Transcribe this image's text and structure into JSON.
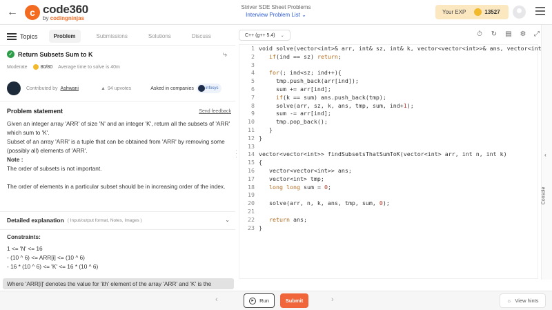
{
  "header": {
    "logo_mark": "c",
    "logo_text": "code360",
    "logo_sub_prefix": "by",
    "logo_sub_brand": "codingninjas",
    "crumb_top": "Striver SDE Sheet Problems",
    "crumb_bottom": "Interview Problem List",
    "exp_label": "Your EXP",
    "exp_value": "13527",
    "icons": {
      "back": "arrow-left-icon",
      "avatar": "user-avatar-icon",
      "menu": "hamburger-icon"
    }
  },
  "left_tabs": {
    "topics": "Topics",
    "items": [
      "Problem",
      "Submissions",
      "Solutions",
      "Discuss"
    ]
  },
  "problem": {
    "title": "Return Subsets Sum to K",
    "difficulty": "Moderate",
    "score": "80/80",
    "avg_time": "Average time to solve is 40m",
    "contributed_prefix": "Contributed by",
    "author": "Ashwani",
    "upvotes": "94 upvotes",
    "companies_label": "Asked in companies",
    "company_text": "infosys",
    "statement_title": "Problem statement",
    "feedback": "Send feedback",
    "para1": "Given an integer array 'ARR' of size 'N' and an integer 'K', return all the subsets of 'ARR' which sum to 'K'.",
    "para2": "Subset of an array 'ARR' is a tuple that can be obtained from 'ARR' by removing some (possibly all) elements of 'ARR'.",
    "note_title": "Note :",
    "note1": "The order of subsets is not important.",
    "note2": "The order of elements in a particular subset should be in increasing order of the index.",
    "detailed_title": "Detailed explanation",
    "detailed_sub": "( Input/output format, Notes, Images )",
    "constraints_title": "Constraints:",
    "constraints": [
      "1 <= 'N' <= 16",
      "- (10 ^ 6) <= ARR[i] <= (10 ^ 6)",
      "- 16 * (10 ^ 6) <= 'K' <= 16 * (10 ^ 6)"
    ],
    "where_text": "Where 'ARR[i]' denotes the value for 'ith' element of the array 'ARR' and 'K' is the"
  },
  "editor": {
    "language": "C++ (g++ 5.4)",
    "toolbar_icons": [
      "timer-icon",
      "reset-icon",
      "notes-icon",
      "settings-icon",
      "fullscreen-icon"
    ],
    "line_numbers": [
      "1",
      "2",
      "3",
      "4",
      "5",
      "6",
      "7",
      "8",
      "9",
      "10",
      "11",
      "12",
      "13",
      "14",
      "15",
      "16",
      "17",
      "18",
      "19",
      "20",
      "21",
      "22",
      "23"
    ],
    "code_lines": [
      "void solve(vector<int>& arr, int& sz, int& k, vector<vector<int>>& ans, vector<int",
      "   if(ind == sz) return;",
      "",
      "   for(; ind<sz; ind++){",
      "     tmp.push_back(arr[ind]);",
      "     sum += arr[ind];",
      "     if(k == sum) ans.push_back(tmp);",
      "     solve(arr, sz, k, ans, tmp, sum, ind+1);",
      "     sum -= arr[ind];",
      "     tmp.pop_back();",
      "   }",
      "}",
      "",
      "vector<vector<int>> findSubsetsThatSumToK(vector<int> arr, int n, int k)",
      "{",
      "   vector<vector<int>> ans;",
      "   vector<int> tmp;",
      "   long long sum = 0;",
      "",
      "   solve(arr, n, k, ans, tmp, sum, 0);",
      "",
      "   return ans;",
      "}"
    ]
  },
  "console": {
    "label": "Console"
  },
  "footer": {
    "run": "Run",
    "submit": "Submit",
    "hints": "View hints"
  }
}
